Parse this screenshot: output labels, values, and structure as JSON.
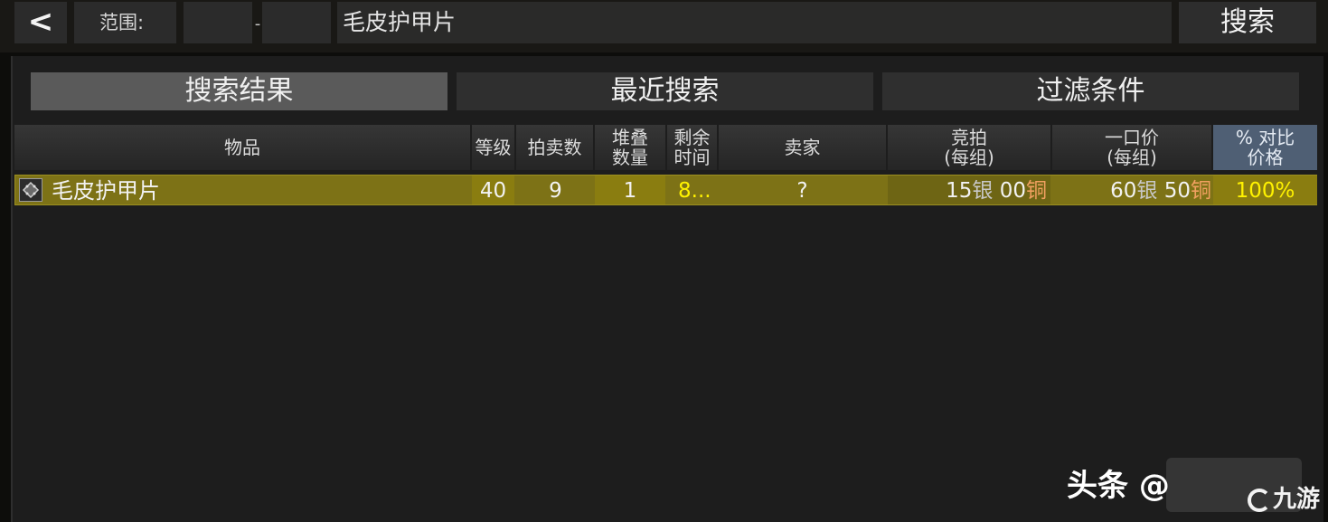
{
  "topbar": {
    "back_label": "<",
    "range_label": "范围:",
    "range_separator": "-",
    "range_min": "",
    "range_max": "",
    "search_value": "毛皮护甲片",
    "search_button": "搜索"
  },
  "tabs": [
    {
      "label": "搜索结果",
      "active": true
    },
    {
      "label": "最近搜索",
      "active": false
    },
    {
      "label": "过滤条件",
      "active": false
    }
  ],
  "table": {
    "headers": {
      "item": "物品",
      "level": "等级",
      "auction_count": "拍卖数",
      "stack_line1": "堆叠",
      "stack_line2": "数量",
      "time_line1": "剩余",
      "time_line2": "时间",
      "seller": "卖家",
      "bid_line1": "竞拍",
      "bid_line2": "(每组)",
      "buyout_line1": "一口价",
      "buyout_line2": "(每组)",
      "pct_line1": "% 对比",
      "pct_line2": "价格"
    },
    "rows": [
      {
        "icon": "leather-armor-patch-icon",
        "item": "毛皮护甲片",
        "level": "40",
        "auction_count": "9",
        "stack": "1",
        "time_left": "8...",
        "seller": "?",
        "bid_silver": "15",
        "bid_silver_unit": "银",
        "bid_copper": "00",
        "bid_copper_unit": "铜",
        "buyout_silver": "60",
        "buyout_silver_unit": "银",
        "buyout_copper": "50",
        "buyout_copper_unit": "铜",
        "price_pct": "100%"
      }
    ]
  },
  "watermark": {
    "text": "头条 @",
    "logo_text": "九游"
  },
  "colors": {
    "row_highlight": "#7d7216",
    "time_left_text": "#fff200",
    "silver_unit": "#c8c8c8",
    "copper_unit": "#f0a060",
    "pct_header": "#4f5f74"
  }
}
